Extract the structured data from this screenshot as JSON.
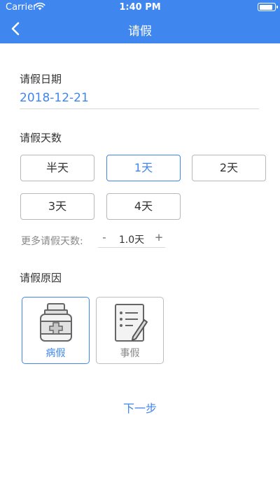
{
  "status_bar": {
    "carrier": "Carrier",
    "time": "1:40 PM",
    "battery_level": 0.9
  },
  "nav": {
    "title": "请假",
    "back_icon": "chevron-left-icon"
  },
  "form": {
    "date_label": "请假日期",
    "date_value": "2018-12-21",
    "days_label": "请假天数",
    "day_options": [
      "半天",
      "1天",
      "2天",
      "3天",
      "4天"
    ],
    "selected_day": "1天",
    "more_days_label": "更多请假天数:",
    "stepper": {
      "minus": "-",
      "value": "1.0天",
      "plus": "+"
    },
    "reason_label": "请假原因",
    "reasons": [
      {
        "label": "病假",
        "icon": "medicine-bottle-icon",
        "selected": true
      },
      {
        "label": "事假",
        "icon": "notepad-pencil-icon",
        "selected": false
      }
    ]
  },
  "next_button": "下一步",
  "colors": {
    "accent": "#3f86ee",
    "border": "#b8b8b8",
    "text": "#333333",
    "muted": "#888888"
  }
}
